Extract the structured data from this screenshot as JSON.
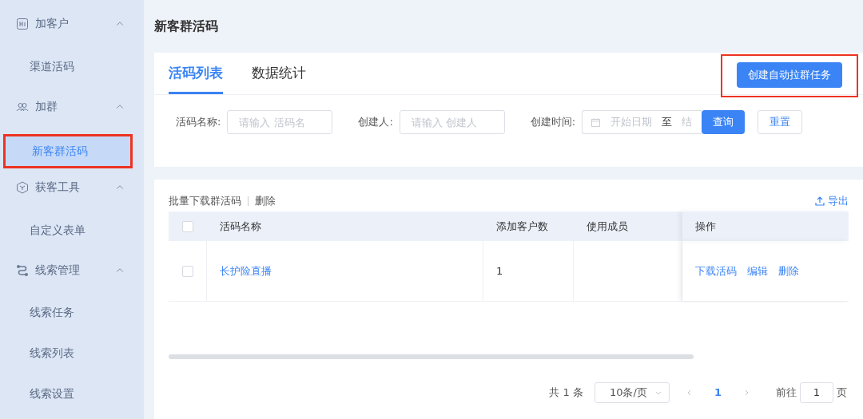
{
  "sidebar": {
    "groups": [
      {
        "label": "加客户",
        "expanded": true,
        "items": [
          {
            "label": "渠道活码",
            "selected": false,
            "highlighted": false
          }
        ]
      },
      {
        "label": "加群",
        "expanded": true,
        "items": [
          {
            "label": "新客群活码",
            "selected": true,
            "highlighted": true
          }
        ]
      },
      {
        "label": "获客工具",
        "expanded": true,
        "items": [
          {
            "label": "自定义表单",
            "selected": false,
            "highlighted": false
          }
        ]
      },
      {
        "label": "线索管理",
        "expanded": true,
        "items": [
          {
            "label": "线索任务",
            "selected": false,
            "highlighted": false
          },
          {
            "label": "线索列表",
            "selected": false,
            "highlighted": false
          },
          {
            "label": "线索设置",
            "selected": false,
            "highlighted": false
          }
        ]
      }
    ]
  },
  "page_title": "新客群活码",
  "tabs": [
    {
      "label": "活码列表",
      "selected": true
    },
    {
      "label": "数据统计",
      "selected": false
    }
  ],
  "create_button": {
    "label": "创建自动拉群任务",
    "highlighted": true
  },
  "filters": {
    "name_label": "活码名称:",
    "name_placeholder": "请输入 活码名",
    "creator_label": "创建人:",
    "creator_placeholder": "请输入 创建人",
    "time_label": "创建时间:",
    "start_placeholder": "开始日期",
    "separator": "至",
    "end_placeholder": "结",
    "query": "查询",
    "reset": "重置"
  },
  "toolbar": {
    "batch_download": "批量下载群活码",
    "delete": "删除",
    "export": "导出"
  },
  "table": {
    "all_checked": false,
    "columns": [
      "活码名称",
      "添加客户数",
      "使用成员",
      "操作"
    ],
    "rows": [
      {
        "checked": false,
        "name": "长护险直播",
        "count": "1",
        "actions": [
          "下载活码",
          "编辑",
          "删除"
        ]
      }
    ]
  },
  "pagination": {
    "total": "共 1 条",
    "page_size": "10条/页",
    "pages": [
      {
        "label": "1",
        "selected": true
      }
    ],
    "goto_label": "前往",
    "goto_value": "1",
    "goto_suffix": "页"
  }
}
